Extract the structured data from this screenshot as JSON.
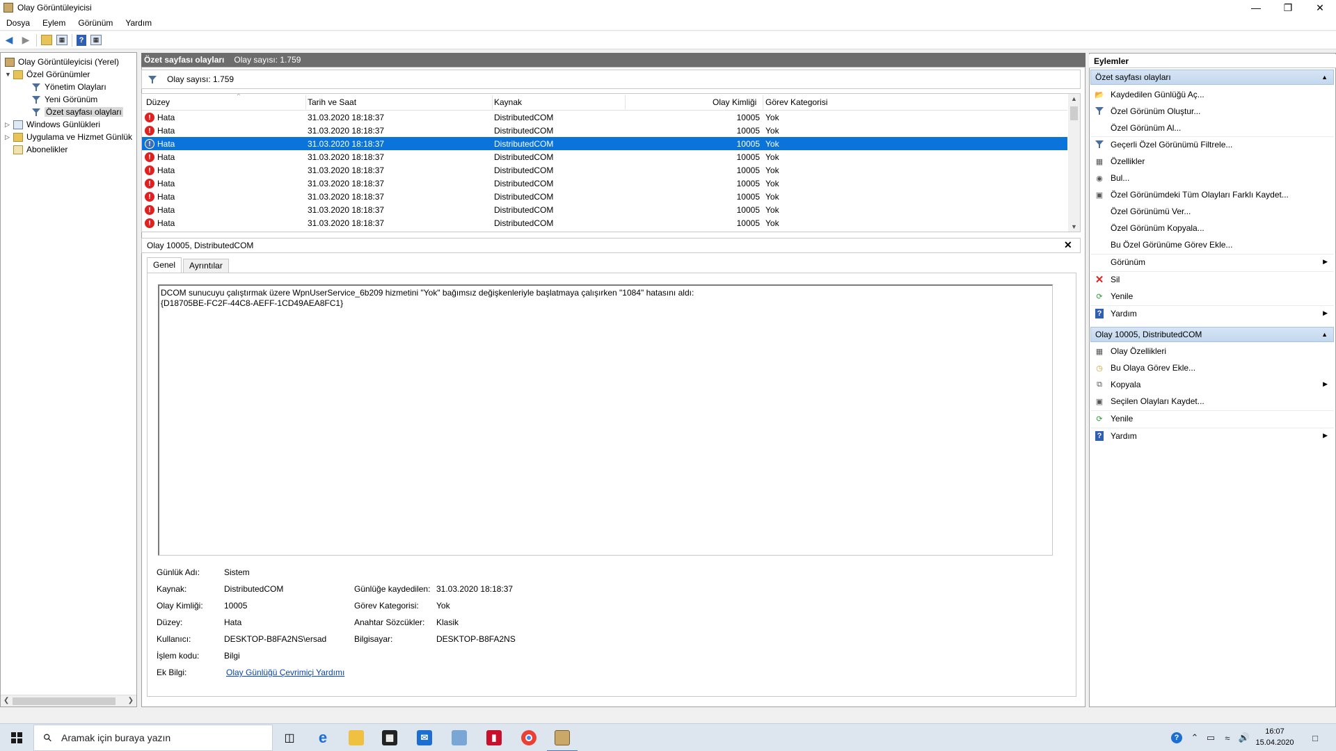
{
  "window": {
    "title": "Olay Görüntüleyicisi"
  },
  "menu": [
    "Dosya",
    "Eylem",
    "Görünüm",
    "Yardım"
  ],
  "tree": {
    "root": "Olay Görüntüleyicisi (Yerel)",
    "custom_views": "Özel Görünümler",
    "admin_events": "Yönetim Olayları",
    "new_view": "Yeni Görünüm",
    "summary_events": "Özet sayfası olayları",
    "windows_logs": "Windows Günlükleri",
    "app_logs": "Uygulama ve Hizmet Günlük",
    "subscriptions": "Abonelikler"
  },
  "middle": {
    "header_title": "Özet sayfası olayları",
    "header_count": "Olay sayısı: 1.759",
    "filter_text": "Olay sayısı: 1.759",
    "columns": [
      "Düzey",
      "Tarih ve Saat",
      "Kaynak",
      "Olay Kimliği",
      "Görev Kategorisi"
    ],
    "rows": [
      {
        "level": "Hata",
        "date": "31.03.2020 18:18:37",
        "source": "DistributedCOM",
        "id": "10005",
        "category": "Yok"
      },
      {
        "level": "Hata",
        "date": "31.03.2020 18:18:37",
        "source": "DistributedCOM",
        "id": "10005",
        "category": "Yok"
      },
      {
        "level": "Hata",
        "date": "31.03.2020 18:18:37",
        "source": "DistributedCOM",
        "id": "10005",
        "category": "Yok"
      },
      {
        "level": "Hata",
        "date": "31.03.2020 18:18:37",
        "source": "DistributedCOM",
        "id": "10005",
        "category": "Yok"
      },
      {
        "level": "Hata",
        "date": "31.03.2020 18:18:37",
        "source": "DistributedCOM",
        "id": "10005",
        "category": "Yok"
      },
      {
        "level": "Hata",
        "date": "31.03.2020 18:18:37",
        "source": "DistributedCOM",
        "id": "10005",
        "category": "Yok"
      },
      {
        "level": "Hata",
        "date": "31.03.2020 18:18:37",
        "source": "DistributedCOM",
        "id": "10005",
        "category": "Yok"
      },
      {
        "level": "Hata",
        "date": "31.03.2020 18:18:37",
        "source": "DistributedCOM",
        "id": "10005",
        "category": "Yok"
      },
      {
        "level": "Hata",
        "date": "31.03.2020 18:18:37",
        "source": "DistributedCOM",
        "id": "10005",
        "category": "Yok"
      }
    ],
    "selected_row": 2
  },
  "detail": {
    "title": "Olay 10005, DistributedCOM",
    "tabs": [
      "Genel",
      "Ayrıntılar"
    ],
    "message_line1": "DCOM sunucuyu çalıştırmak üzere WpnUserService_6b209 hizmetini \"Yok\" bağımsız değişkenleriyle başlatmaya çalışırken \"1084\" hatasını aldı:",
    "message_line2": "{D18705BE-FC2F-44C8-AEFF-1CD49AEA8FC1}",
    "fields": {
      "log_name_label": "Günlük Adı:",
      "log_name": "Sistem",
      "source_label": "Kaynak:",
      "source": "DistributedCOM",
      "logged_label": "Günlüğe kaydedilen:",
      "logged": "31.03.2020 18:18:37",
      "event_id_label": "Olay Kimliği:",
      "event_id": "10005",
      "task_cat_label": "Görev Kategorisi:",
      "task_cat": "Yok",
      "level_label": "Düzey:",
      "level": "Hata",
      "keywords_label": "Anahtar Sözcükler:",
      "keywords": "Klasik",
      "user_label": "Kullanıcı:",
      "user": "DESKTOP-B8FA2NS\\ersad",
      "computer_label": "Bilgisayar:",
      "computer": "DESKTOP-B8FA2NS",
      "opcode_label": "İşlem kodu:",
      "opcode": "Bilgi",
      "more_info_label": "Ek Bilgi:",
      "more_info_link": "Olay Günlüğü Çevrimiçi Yardımı"
    }
  },
  "actions": {
    "title": "Eylemler",
    "section1": "Özet sayfası olayları",
    "items1": [
      "Kaydedilen Günlüğü Aç...",
      "Özel Görünüm Oluştur...",
      "Özel Görünüm Al...",
      "Geçerli Özel Görünümü Filtrele...",
      "Özellikler",
      "Bul...",
      "Özel Görünümdeki Tüm Olayları Farklı Kaydet...",
      "Özel Görünümü Ver...",
      "Özel Görünüm Kopyala...",
      "Bu Özel Görünüme Görev Ekle...",
      "Görünüm",
      "Sil",
      "Yenile",
      "Yardım"
    ],
    "section2": "Olay 10005, DistributedCOM",
    "items2": [
      "Olay Özellikleri",
      "Bu Olaya Görev Ekle...",
      "Kopyala",
      "Seçilen Olayları Kaydet...",
      "Yenile",
      "Yardım"
    ]
  },
  "taskbar": {
    "search_placeholder": "Aramak için buraya yazın",
    "time": "16:07",
    "date": "15.04.2020"
  }
}
